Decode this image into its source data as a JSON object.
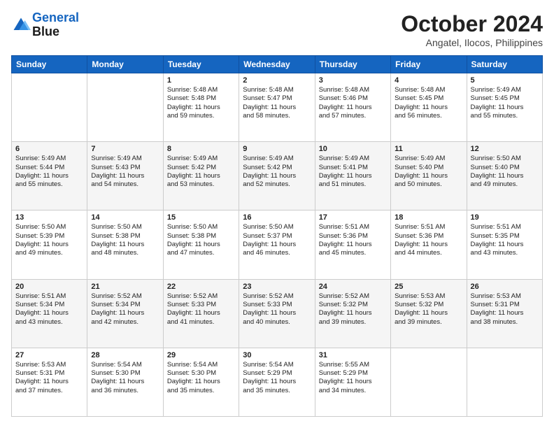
{
  "header": {
    "logo_line1": "General",
    "logo_line2": "Blue",
    "month": "October 2024",
    "location": "Angatel, Ilocos, Philippines"
  },
  "weekdays": [
    "Sunday",
    "Monday",
    "Tuesday",
    "Wednesday",
    "Thursday",
    "Friday",
    "Saturday"
  ],
  "weeks": [
    [
      {
        "day": "",
        "info": ""
      },
      {
        "day": "",
        "info": ""
      },
      {
        "day": "1",
        "info": "Sunrise: 5:48 AM\nSunset: 5:48 PM\nDaylight: 11 hours\nand 59 minutes."
      },
      {
        "day": "2",
        "info": "Sunrise: 5:48 AM\nSunset: 5:47 PM\nDaylight: 11 hours\nand 58 minutes."
      },
      {
        "day": "3",
        "info": "Sunrise: 5:48 AM\nSunset: 5:46 PM\nDaylight: 11 hours\nand 57 minutes."
      },
      {
        "day": "4",
        "info": "Sunrise: 5:48 AM\nSunset: 5:45 PM\nDaylight: 11 hours\nand 56 minutes."
      },
      {
        "day": "5",
        "info": "Sunrise: 5:49 AM\nSunset: 5:45 PM\nDaylight: 11 hours\nand 55 minutes."
      }
    ],
    [
      {
        "day": "6",
        "info": "Sunrise: 5:49 AM\nSunset: 5:44 PM\nDaylight: 11 hours\nand 55 minutes."
      },
      {
        "day": "7",
        "info": "Sunrise: 5:49 AM\nSunset: 5:43 PM\nDaylight: 11 hours\nand 54 minutes."
      },
      {
        "day": "8",
        "info": "Sunrise: 5:49 AM\nSunset: 5:42 PM\nDaylight: 11 hours\nand 53 minutes."
      },
      {
        "day": "9",
        "info": "Sunrise: 5:49 AM\nSunset: 5:42 PM\nDaylight: 11 hours\nand 52 minutes."
      },
      {
        "day": "10",
        "info": "Sunrise: 5:49 AM\nSunset: 5:41 PM\nDaylight: 11 hours\nand 51 minutes."
      },
      {
        "day": "11",
        "info": "Sunrise: 5:49 AM\nSunset: 5:40 PM\nDaylight: 11 hours\nand 50 minutes."
      },
      {
        "day": "12",
        "info": "Sunrise: 5:50 AM\nSunset: 5:40 PM\nDaylight: 11 hours\nand 49 minutes."
      }
    ],
    [
      {
        "day": "13",
        "info": "Sunrise: 5:50 AM\nSunset: 5:39 PM\nDaylight: 11 hours\nand 49 minutes."
      },
      {
        "day": "14",
        "info": "Sunrise: 5:50 AM\nSunset: 5:38 PM\nDaylight: 11 hours\nand 48 minutes."
      },
      {
        "day": "15",
        "info": "Sunrise: 5:50 AM\nSunset: 5:38 PM\nDaylight: 11 hours\nand 47 minutes."
      },
      {
        "day": "16",
        "info": "Sunrise: 5:50 AM\nSunset: 5:37 PM\nDaylight: 11 hours\nand 46 minutes."
      },
      {
        "day": "17",
        "info": "Sunrise: 5:51 AM\nSunset: 5:36 PM\nDaylight: 11 hours\nand 45 minutes."
      },
      {
        "day": "18",
        "info": "Sunrise: 5:51 AM\nSunset: 5:36 PM\nDaylight: 11 hours\nand 44 minutes."
      },
      {
        "day": "19",
        "info": "Sunrise: 5:51 AM\nSunset: 5:35 PM\nDaylight: 11 hours\nand 43 minutes."
      }
    ],
    [
      {
        "day": "20",
        "info": "Sunrise: 5:51 AM\nSunset: 5:34 PM\nDaylight: 11 hours\nand 43 minutes."
      },
      {
        "day": "21",
        "info": "Sunrise: 5:52 AM\nSunset: 5:34 PM\nDaylight: 11 hours\nand 42 minutes."
      },
      {
        "day": "22",
        "info": "Sunrise: 5:52 AM\nSunset: 5:33 PM\nDaylight: 11 hours\nand 41 minutes."
      },
      {
        "day": "23",
        "info": "Sunrise: 5:52 AM\nSunset: 5:33 PM\nDaylight: 11 hours\nand 40 minutes."
      },
      {
        "day": "24",
        "info": "Sunrise: 5:52 AM\nSunset: 5:32 PM\nDaylight: 11 hours\nand 39 minutes."
      },
      {
        "day": "25",
        "info": "Sunrise: 5:53 AM\nSunset: 5:32 PM\nDaylight: 11 hours\nand 39 minutes."
      },
      {
        "day": "26",
        "info": "Sunrise: 5:53 AM\nSunset: 5:31 PM\nDaylight: 11 hours\nand 38 minutes."
      }
    ],
    [
      {
        "day": "27",
        "info": "Sunrise: 5:53 AM\nSunset: 5:31 PM\nDaylight: 11 hours\nand 37 minutes."
      },
      {
        "day": "28",
        "info": "Sunrise: 5:54 AM\nSunset: 5:30 PM\nDaylight: 11 hours\nand 36 minutes."
      },
      {
        "day": "29",
        "info": "Sunrise: 5:54 AM\nSunset: 5:30 PM\nDaylight: 11 hours\nand 35 minutes."
      },
      {
        "day": "30",
        "info": "Sunrise: 5:54 AM\nSunset: 5:29 PM\nDaylight: 11 hours\nand 35 minutes."
      },
      {
        "day": "31",
        "info": "Sunrise: 5:55 AM\nSunset: 5:29 PM\nDaylight: 11 hours\nand 34 minutes."
      },
      {
        "day": "",
        "info": ""
      },
      {
        "day": "",
        "info": ""
      }
    ]
  ]
}
